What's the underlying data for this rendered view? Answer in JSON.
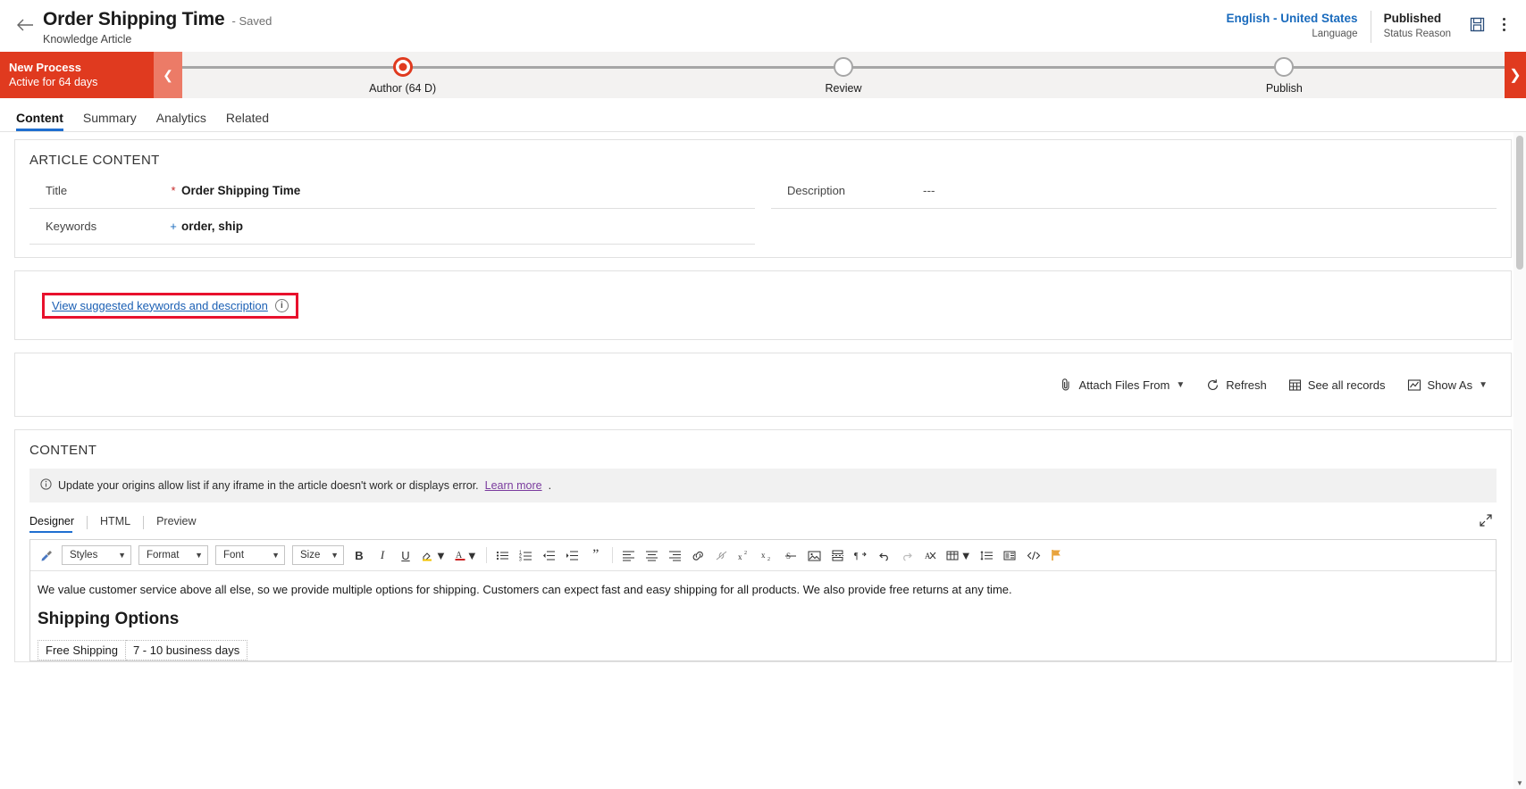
{
  "header": {
    "back_icon": "back-arrow-icon",
    "title": "Order Shipping Time",
    "saved_state": "- Saved",
    "entity": "Knowledge Article",
    "language_value": "English - United States",
    "language_label": "Language",
    "status_value": "Published",
    "status_label": "Status Reason",
    "save_icon": "save-icon",
    "more_icon": "more-commands-icon"
  },
  "process": {
    "stage_title": "New Process",
    "stage_sub": "Active for 64 days",
    "collapse_icon": "chevron-left-icon",
    "next_icon": "chevron-right-icon",
    "steps": [
      {
        "label": "Author  (64 D)",
        "active": true
      },
      {
        "label": "Review",
        "active": false
      },
      {
        "label": "Publish",
        "active": false
      }
    ]
  },
  "tabs": [
    {
      "label": "Content",
      "active": true
    },
    {
      "label": "Summary",
      "active": false
    },
    {
      "label": "Analytics",
      "active": false
    },
    {
      "label": "Related",
      "active": false
    }
  ],
  "article_content": {
    "section_title": "ARTICLE CONTENT",
    "title_label": "Title",
    "title_required": "*",
    "title_value": "Order Shipping Time",
    "keywords_label": "Keywords",
    "keywords_required": "+",
    "keywords_value": "order, ship",
    "description_label": "Description",
    "description_value": "---"
  },
  "suggestion": {
    "link_text": "View suggested keywords and description",
    "info_icon": "info-icon"
  },
  "attachments_toolbar": {
    "attach_icon": "paperclip-icon",
    "attach_label": "Attach Files From",
    "attach_chevron": "chevron-down-icon",
    "refresh_icon": "refresh-icon",
    "refresh_label": "Refresh",
    "records_icon": "grid-icon",
    "records_label": "See all records",
    "showas_icon": "chart-icon",
    "showas_label": "Show As",
    "showas_chevron": "chevron-down-icon"
  },
  "content_section": {
    "section_title": "CONTENT",
    "notice_icon": "info-icon",
    "notice_text": "Update your origins allow list if any iframe in the article doesn't work or displays error.",
    "notice_link": "Learn more",
    "notice_period": ".",
    "expand_icon": "expand-icon",
    "editor_tabs": [
      {
        "label": "Designer",
        "active": true
      },
      {
        "label": "HTML",
        "active": false
      },
      {
        "label": "Preview",
        "active": false
      }
    ],
    "toolbar": {
      "format_painter_icon": "format-painter-icon",
      "styles_label": "Styles",
      "format_label": "Format",
      "font_label": "Font",
      "size_label": "Size",
      "bold": "B",
      "italic": "I",
      "underline": "U",
      "highlight_icon": "text-highlight-icon",
      "text_color_icon": "text-color-icon",
      "bullet_list_icon": "bulleted-list-icon",
      "numbered_list_icon": "numbered-list-icon",
      "outdent_icon": "decrease-indent-icon",
      "indent_icon": "increase-indent-icon",
      "blockquote_icon": "blockquote-icon",
      "align_left_icon": "align-left-icon",
      "align_center_icon": "align-center-icon",
      "align_right_icon": "align-right-icon",
      "link_icon": "insert-link-icon",
      "unlink_icon": "remove-link-icon",
      "superscript_icon": "superscript-icon",
      "subscript_icon": "subscript-icon",
      "strikethrough_icon": "strikethrough-icon",
      "image_icon": "insert-image-icon",
      "page_break_icon": "page-break-icon",
      "ltr_icon": "left-to-right-icon",
      "undo_icon": "undo-icon",
      "redo_icon": "redo-icon",
      "clear_format_icon": "clear-formatting-icon",
      "table_icon": "insert-table-icon",
      "line_spacing_icon": "line-spacing-icon",
      "template_icon": "insert-template-icon",
      "source_icon": "source-code-icon",
      "flag_icon": "flag-icon"
    },
    "document": {
      "paragraph": "We value customer service above all else, so we provide multiple options for shipping. Customers can expect fast and easy shipping for all products. We also provide free returns at any time.",
      "heading": "Shipping Options",
      "table_rows": [
        {
          "option": "Free Shipping",
          "duration": "7 - 10 business days"
        }
      ]
    }
  },
  "colors": {
    "accent_red": "#e03a1f",
    "link_blue": "#1a6bbd",
    "tab_underline": "#1f6fd0",
    "highlight_border": "#e8112d",
    "visited_link": "#7a3b9e"
  }
}
